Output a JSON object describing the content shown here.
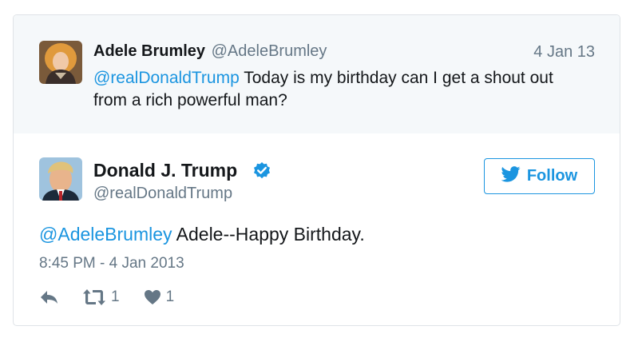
{
  "parent_tweet": {
    "name": "Adele Brumley",
    "handle": "@AdeleBrumley",
    "date": "4 Jan 13",
    "mention": "@realDonaldTrump",
    "text": " Today is my birthday can I get a shout out from a rich powerful man?"
  },
  "main_tweet": {
    "name": "Donald J. Trump",
    "handle": "@realDonaldTrump",
    "mention": "@AdeleBrumley",
    "text": " Adele--Happy Birthday.",
    "timestamp": "8:45 PM - 4 Jan 2013",
    "retweet_count": "1",
    "like_count": "1"
  },
  "follow_button": {
    "label": "Follow"
  },
  "icons": {
    "verified": "verified-badge-icon",
    "bird": "twitter-bird-icon",
    "reply": "reply-icon",
    "retweet": "retweet-icon",
    "like": "heart-icon"
  },
  "colors": {
    "accent": "#1b95e0",
    "muted": "#657786",
    "parent_bg": "#f5f8fa",
    "border": "#dfe3e7"
  }
}
